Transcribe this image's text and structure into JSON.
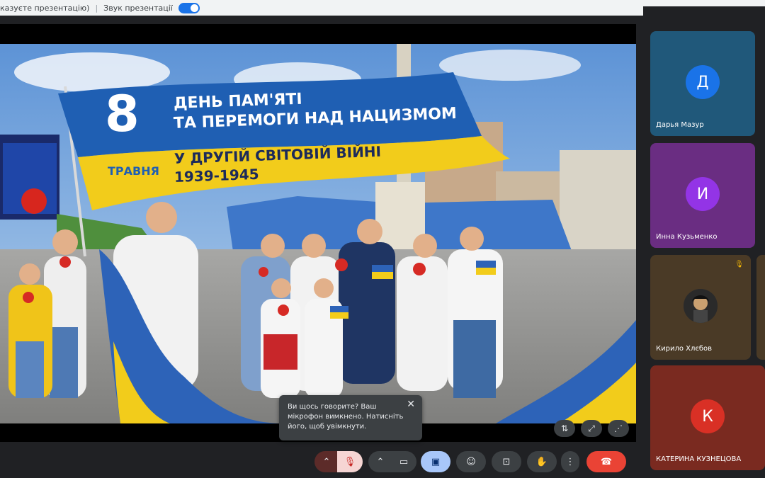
{
  "topbar": {
    "presenter_text": "казуєте презентацію)",
    "sound_label": "Звук презентації"
  },
  "slide": {
    "day_number": "8",
    "month": "ТРАВНЯ",
    "title_line1": "ДЕНЬ ПАМ'ЯТІ",
    "title_line2": "ТА ПЕРЕМОГИ НАД НАЦИЗМОМ",
    "subtitle_line1": "У ДРУГІЙ СВІТОВІЙ ВІЙНІ",
    "subtitle_line2": "1939-1945",
    "colors": {
      "blue": "#1f5fb3",
      "yellow": "#f2cc1b"
    }
  },
  "tooltip": {
    "text_line1": "Ви щось говорите? Ваш",
    "text_line2": "мікрофон вимкнено. Натисніть",
    "text_line3": "його, щоб увімкнути."
  },
  "participants": [
    {
      "name": "Дарья Мазур",
      "initial": "Д",
      "avatar_color": "#1a73e8",
      "tile_color": "#20587a"
    },
    {
      "name": "Инна Кузьменко",
      "initial": "И",
      "avatar_color": "#9334e6",
      "tile_color": "#6a2d82"
    },
    {
      "name": "Кирило Хлєбов",
      "initial": "",
      "avatar_color": "#333333",
      "tile_color": "#4a3a26"
    },
    {
      "name": "КАТЕРИНА КУЗНЕЦОВА",
      "initial": "К",
      "avatar_color": "#d93025",
      "tile_color": "#7a2a20"
    }
  ]
}
